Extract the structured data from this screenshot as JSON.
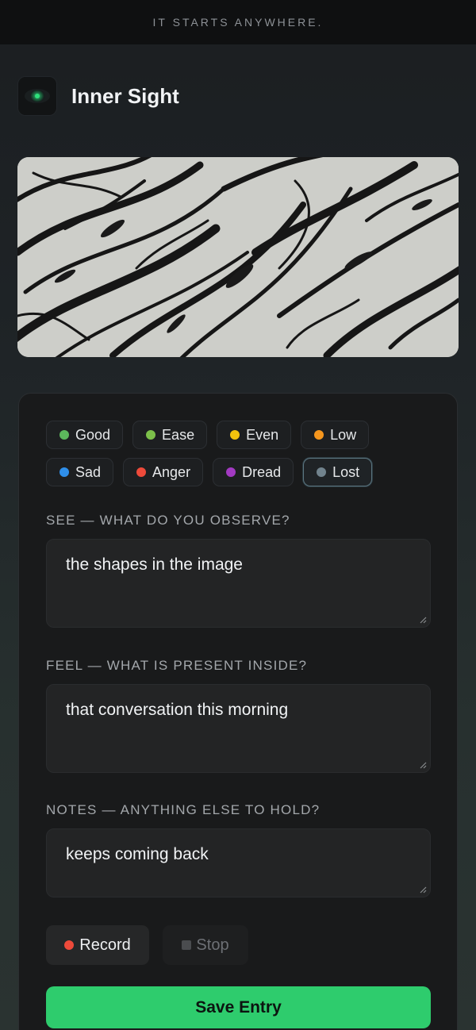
{
  "banner": {
    "text": "IT STARTS ANYWHERE."
  },
  "app": {
    "title": "Inner Sight"
  },
  "moods": [
    [
      {
        "label": "Good",
        "color": "#5cb85c"
      },
      {
        "label": "Ease",
        "color": "#7cc04a"
      },
      {
        "label": "Even",
        "color": "#f4c20d"
      },
      {
        "label": "Low",
        "color": "#f5961d"
      }
    ],
    [
      {
        "label": "Sad",
        "color": "#2f8fea"
      },
      {
        "label": "Anger",
        "color": "#ee4a3a"
      },
      {
        "label": "Dread",
        "color": "#a23ac2"
      },
      {
        "label": "Lost",
        "color": "#71838d",
        "selected": true
      }
    ]
  ],
  "see": {
    "label": "SEE — WHAT DO YOU OBSERVE?",
    "value": "the shapes in the image"
  },
  "feel": {
    "label": "FEEL — WHAT IS PRESENT INSIDE?",
    "value": "that conversation this morning"
  },
  "notes": {
    "label": "NOTES — ANYTHING ELSE TO HOLD?",
    "value": "keeps coming back"
  },
  "controls": {
    "record": "Record",
    "stop": "Stop",
    "save": "Save Entry"
  },
  "colors": {
    "accent": "#2ecc6d",
    "record_dot": "#ee4a3a"
  }
}
